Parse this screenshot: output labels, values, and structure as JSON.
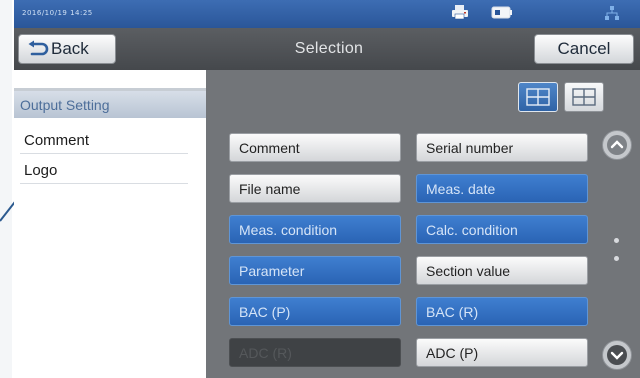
{
  "status": {
    "time": "2016/10/19 14:25"
  },
  "titlebar": {
    "back_label": "Back",
    "title": "Selection",
    "cancel_label": "Cancel"
  },
  "sidebar": {
    "tab_label": "Output Setting",
    "items": [
      {
        "label": "Comment"
      },
      {
        "label": "Logo"
      }
    ]
  },
  "view_toggle": {
    "active": "two-column",
    "options": [
      "two-column",
      "four-grid"
    ]
  },
  "options": [
    {
      "label": "Comment",
      "state": "off"
    },
    {
      "label": "Serial number",
      "state": "off"
    },
    {
      "label": "File name",
      "state": "off"
    },
    {
      "label": "Meas. date",
      "state": "on"
    },
    {
      "label": "Meas. condition",
      "state": "on"
    },
    {
      "label": "Calc. condition",
      "state": "on"
    },
    {
      "label": "Parameter",
      "state": "on"
    },
    {
      "label": "Section value",
      "state": "off"
    },
    {
      "label": "BAC (P)",
      "state": "on"
    },
    {
      "label": "BAC (R)",
      "state": "on"
    },
    {
      "label": "ADC (R)",
      "state": "disabled"
    },
    {
      "label": "ADC (P)",
      "state": "off"
    }
  ],
  "icons": {
    "back": "back-arrow-icon",
    "printer": "printer-icon",
    "battery": "battery-icon",
    "network": "network-icon",
    "scroll_up": "chevron-up-icon",
    "scroll_down": "chevron-down-icon"
  },
  "colors": {
    "accent": "#2a64b4",
    "statusbar": "#2a5699",
    "titlebar": "#45484c"
  }
}
